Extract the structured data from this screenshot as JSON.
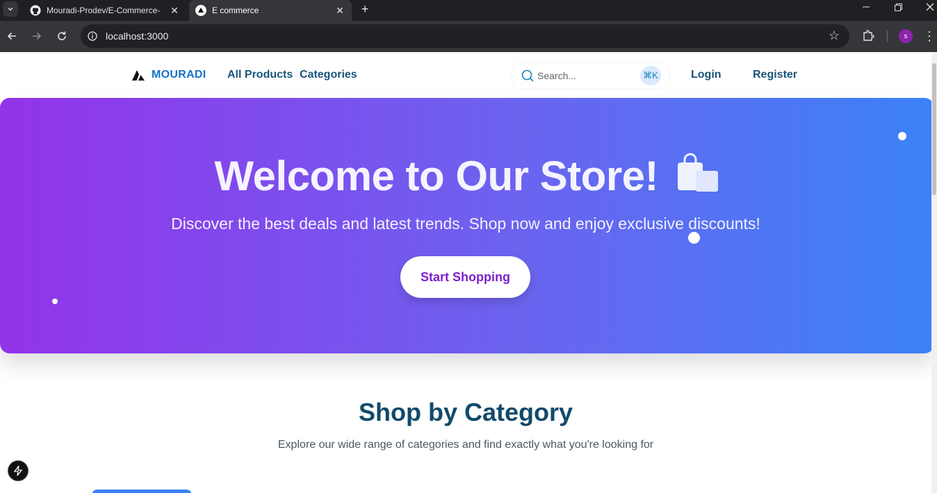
{
  "browser": {
    "tabs": [
      {
        "title": "Mouradi-Prodev/E-Commerce-",
        "favicon": "github-icon",
        "active": false
      },
      {
        "title": "E commerce",
        "favicon": "vercel-triangle-icon",
        "active": true
      }
    ],
    "url": "localhost:3000",
    "profile_initial": "s"
  },
  "site": {
    "logo_text": "MOURADI",
    "nav_links": [
      "All Products",
      "Categories"
    ],
    "search_placeholder": "Search...",
    "search_shortcut": "⌘K",
    "login_label": "Login",
    "register_label": "Register"
  },
  "hero": {
    "title": "Welcome to Our Store!",
    "subtitle": "Discover the best deals and latest trends. Shop now and enjoy exclusive discounts!",
    "cta_label": "Start Shopping",
    "icon": "shopping-bags-icon"
  },
  "categories_section": {
    "title": "Shop by Category",
    "subtitle": "Explore our wide range of categories and find exactly what you're looking for"
  },
  "colors": {
    "hero_gradient_start": "#9333ea",
    "hero_gradient_end": "#3b82f6",
    "brand_blue": "#1673c7",
    "cta_text": "#7e22ce",
    "heading": "#124a6b"
  }
}
